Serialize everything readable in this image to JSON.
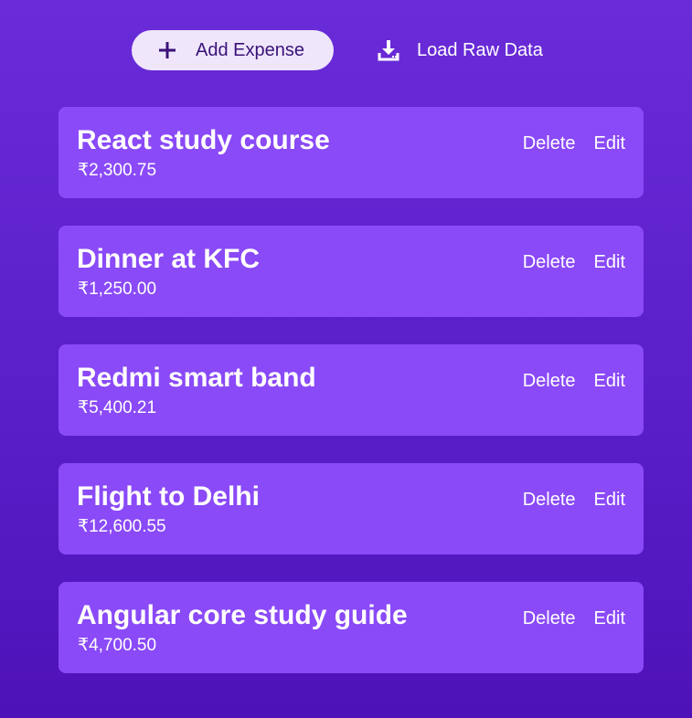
{
  "toolbar": {
    "add_label": "Add Expense",
    "add_icon": "plus-icon",
    "load_label": "Load Raw Data",
    "load_icon": "download-icon"
  },
  "expenses": [
    {
      "title": "React study course",
      "amount": "₹2,300.75",
      "delete_label": "Delete",
      "edit_label": "Edit"
    },
    {
      "title": "Dinner at KFC",
      "amount": "₹1,250.00",
      "delete_label": "Delete",
      "edit_label": "Edit"
    },
    {
      "title": "Redmi smart band",
      "amount": "₹5,400.21",
      "delete_label": "Delete",
      "edit_label": "Edit"
    },
    {
      "title": "Flight to Delhi",
      "amount": "₹12,600.55",
      "delete_label": "Delete",
      "edit_label": "Edit"
    },
    {
      "title": "Angular core study guide",
      "amount": "₹4,700.50",
      "delete_label": "Delete",
      "edit_label": "Edit"
    }
  ],
  "colors": {
    "background": "#5a1fc9",
    "card": "#8a4af7",
    "add_button": "#efe6fb",
    "add_text": "#3a1278",
    "text": "#ffffff"
  }
}
